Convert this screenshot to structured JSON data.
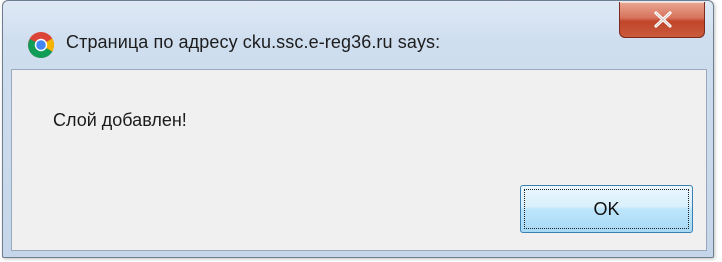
{
  "dialog": {
    "title": "Страница по адресу cku.ssc.e-reg36.ru says:",
    "message": "Слой добавлен!",
    "ok_label": "OK",
    "title_icon": "chrome-icon",
    "close_icon": "close-icon"
  },
  "colors": {
    "frame": "#c5d6ea",
    "close_button": "#c1452a",
    "content_bg": "#f0f0f0",
    "ok_button": "#bee6fd"
  }
}
